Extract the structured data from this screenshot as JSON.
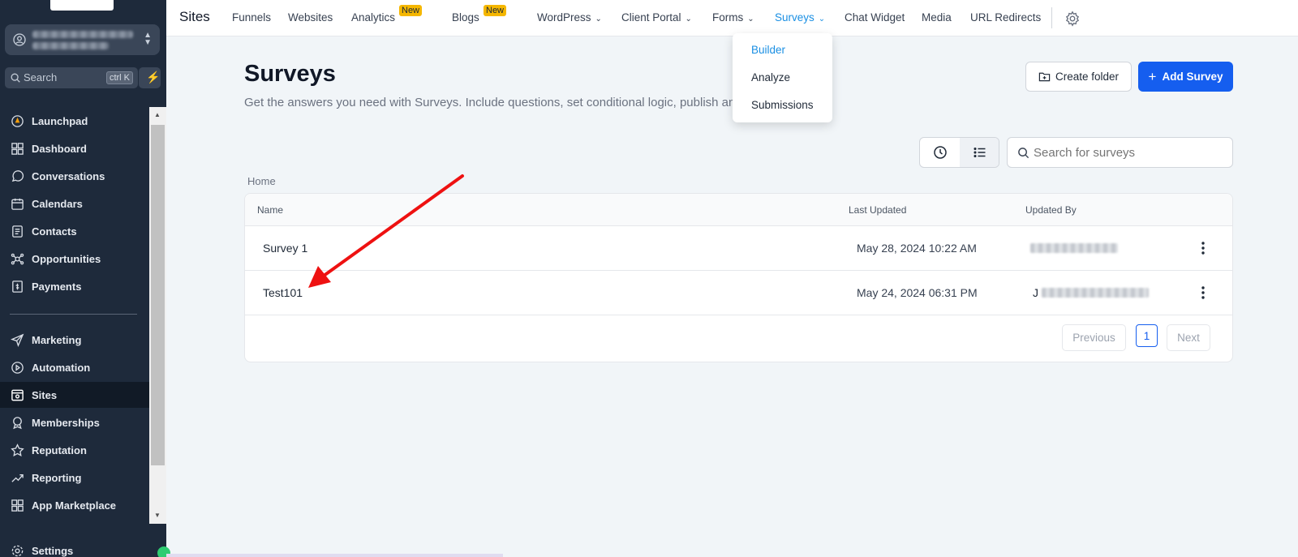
{
  "sidebar": {
    "search": {
      "placeholder": "Search",
      "shortcut": "ctrl K"
    },
    "items": [
      {
        "label": "Launchpad",
        "icon": "launchpad-icon"
      },
      {
        "label": "Dashboard",
        "icon": "dashboard-icon"
      },
      {
        "label": "Conversations",
        "icon": "chat-icon"
      },
      {
        "label": "Calendars",
        "icon": "calendar-icon"
      },
      {
        "label": "Contacts",
        "icon": "contacts-icon"
      },
      {
        "label": "Opportunities",
        "icon": "opportunities-icon"
      },
      {
        "label": "Payments",
        "icon": "payments-icon"
      },
      {
        "label": "Marketing",
        "icon": "send-icon"
      },
      {
        "label": "Automation",
        "icon": "automation-icon"
      },
      {
        "label": "Sites",
        "icon": "sites-icon",
        "active": true
      },
      {
        "label": "Memberships",
        "icon": "award-icon"
      },
      {
        "label": "Reputation",
        "icon": "star-icon"
      },
      {
        "label": "Reporting",
        "icon": "trend-icon"
      },
      {
        "label": "App Marketplace",
        "icon": "grid-icon"
      },
      {
        "label": "Settings",
        "icon": "gear-icon"
      }
    ]
  },
  "topnav": {
    "title": "Sites",
    "items": [
      {
        "label": "Funnels"
      },
      {
        "label": "Websites"
      },
      {
        "label": "Analytics",
        "badge": "New"
      },
      {
        "label": "Blogs",
        "badge": "New"
      },
      {
        "label": "WordPress",
        "dropdown": true
      },
      {
        "label": "Client Portal",
        "dropdown": true
      },
      {
        "label": "Forms",
        "dropdown": true
      },
      {
        "label": "Surveys",
        "dropdown": true,
        "active": true
      },
      {
        "label": "Chat Widget"
      },
      {
        "label": "Media"
      },
      {
        "label": "URL Redirects"
      }
    ],
    "surveys_menu": [
      "Builder",
      "Analyze",
      "Submissions"
    ]
  },
  "page": {
    "title": "Surveys",
    "description": "Get the answers you need with Surveys. Include questions, set conditional logic, publish and view responses.",
    "create_folder": "Create folder",
    "add_survey": "Add Survey",
    "search_placeholder": "Search for surveys",
    "breadcrumb": "Home"
  },
  "table": {
    "columns": [
      "Name",
      "Last Updated",
      "Updated By"
    ],
    "rows": [
      {
        "name": "Survey 1",
        "last_updated": "May 28, 2024 10:22 AM",
        "updated_by_initial": ""
      },
      {
        "name": "Test101",
        "last_updated": "May 24, 2024 06:31 PM",
        "updated_by_initial": "J"
      }
    ],
    "pagination": {
      "previous": "Previous",
      "current": "1",
      "next": "Next"
    }
  },
  "colors": {
    "primary": "#155eef",
    "active_link": "#1a8fe3",
    "sidebar_bg": "#1e2a3b",
    "badge": "#f5b700",
    "annotation_arrow": "#ee1111"
  }
}
